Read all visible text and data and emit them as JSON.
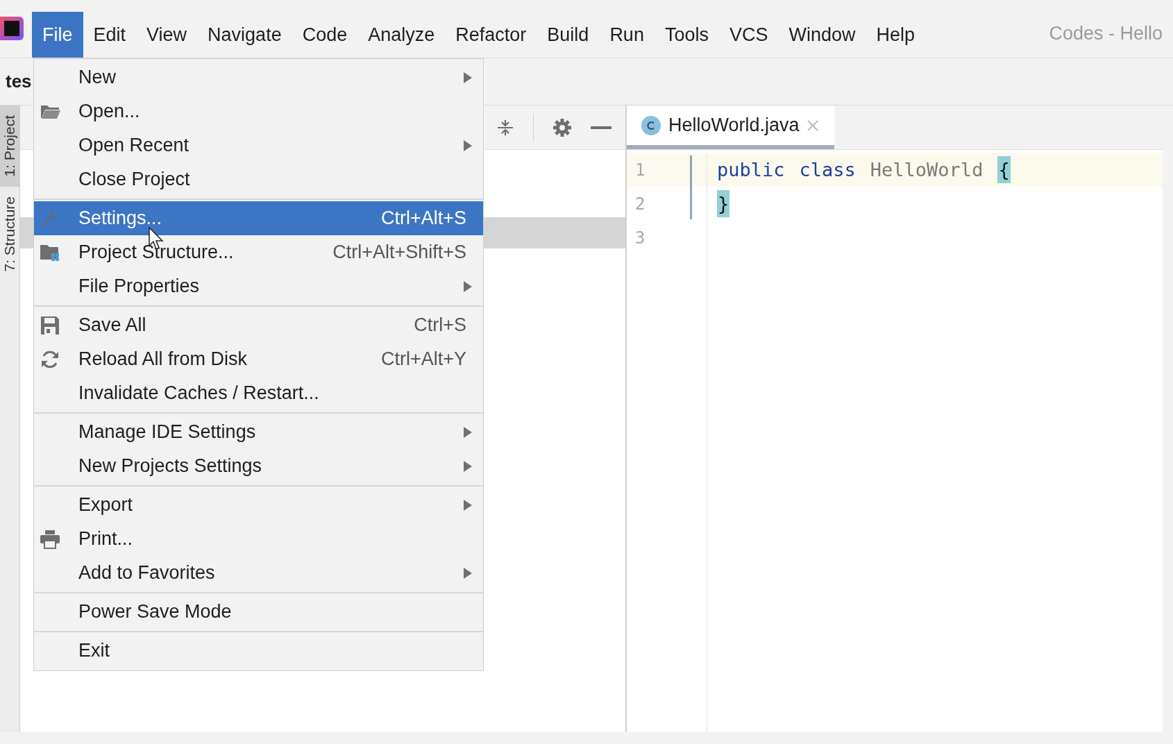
{
  "menubar": {
    "items": [
      {
        "label": "File",
        "selected": true
      },
      {
        "label": "Edit",
        "selected": false
      },
      {
        "label": "View",
        "selected": false
      },
      {
        "label": "Navigate",
        "selected": false
      },
      {
        "label": "Code",
        "selected": false
      },
      {
        "label": "Analyze",
        "selected": false
      },
      {
        "label": "Refactor",
        "selected": false
      },
      {
        "label": "Build",
        "selected": false
      },
      {
        "label": "Run",
        "selected": false
      },
      {
        "label": "Tools",
        "selected": false
      },
      {
        "label": "VCS",
        "selected": false
      },
      {
        "label": "Window",
        "selected": false
      },
      {
        "label": "Help",
        "selected": false
      }
    ],
    "title": "Codes - Hello"
  },
  "toolbar": {
    "project_label": "tes"
  },
  "tool_strip": {
    "tabs": [
      {
        "label": "1: Project",
        "selected": true
      },
      {
        "label": "7: Structure",
        "selected": false
      }
    ]
  },
  "editor": {
    "tabs": [
      {
        "label": "HelloWorld.java",
        "selected": true
      }
    ],
    "lines": [
      {
        "number": "1",
        "current": true,
        "tokens": [
          {
            "kind": "keyword",
            "text": "public"
          },
          {
            "kind": "keyword",
            "text": "class"
          },
          {
            "kind": "name",
            "text": "HelloWorld"
          },
          {
            "kind": "brace-match",
            "text": "{"
          }
        ]
      },
      {
        "number": "2",
        "current": false,
        "tokens": [
          {
            "kind": "brace-match",
            "text": "}"
          }
        ]
      },
      {
        "number": "3",
        "current": false
      }
    ]
  },
  "file_menu": {
    "entries": [
      {
        "kind": "item",
        "label": "New",
        "submenu": true,
        "selected": false
      },
      {
        "kind": "item",
        "label": "Open...",
        "submenu": false,
        "selected": false
      },
      {
        "kind": "item",
        "label": "Open Recent",
        "submenu": true,
        "selected": false
      },
      {
        "kind": "item",
        "label": "Close Project",
        "submenu": false,
        "selected": false
      },
      {
        "kind": "separator"
      },
      {
        "kind": "item",
        "label": "Settings...",
        "shortcut": "Ctrl+Alt+S",
        "submenu": false,
        "selected": true
      },
      {
        "kind": "item",
        "label": "Project Structure...",
        "shortcut": "Ctrl+Alt+Shift+S",
        "submenu": false,
        "selected": false
      },
      {
        "kind": "item",
        "label": "File Properties",
        "submenu": true,
        "selected": false
      },
      {
        "kind": "separator"
      },
      {
        "kind": "item",
        "label": "Save All",
        "shortcut": "Ctrl+S",
        "submenu": false,
        "selected": false
      },
      {
        "kind": "item",
        "label": "Reload All from Disk",
        "shortcut": "Ctrl+Alt+Y",
        "submenu": false,
        "selected": false
      },
      {
        "kind": "item",
        "label": "Invalidate Caches / Restart...",
        "submenu": false,
        "selected": false
      },
      {
        "kind": "separator"
      },
      {
        "kind": "item",
        "label": "Manage IDE Settings",
        "submenu": true,
        "selected": false
      },
      {
        "kind": "item",
        "label": "New Projects Settings",
        "submenu": true,
        "selected": false
      },
      {
        "kind": "separator"
      },
      {
        "kind": "item",
        "label": "Export",
        "submenu": true,
        "selected": false
      },
      {
        "kind": "item",
        "label": "Print...",
        "submenu": false,
        "selected": false
      },
      {
        "kind": "item",
        "label": "Add to Favorites",
        "submenu": true,
        "selected": false
      },
      {
        "kind": "separator"
      },
      {
        "kind": "item",
        "label": "Power Save Mode",
        "submenu": false,
        "selected": false
      },
      {
        "kind": "separator"
      },
      {
        "kind": "item",
        "label": "Exit",
        "submenu": false,
        "selected": false
      }
    ]
  }
}
